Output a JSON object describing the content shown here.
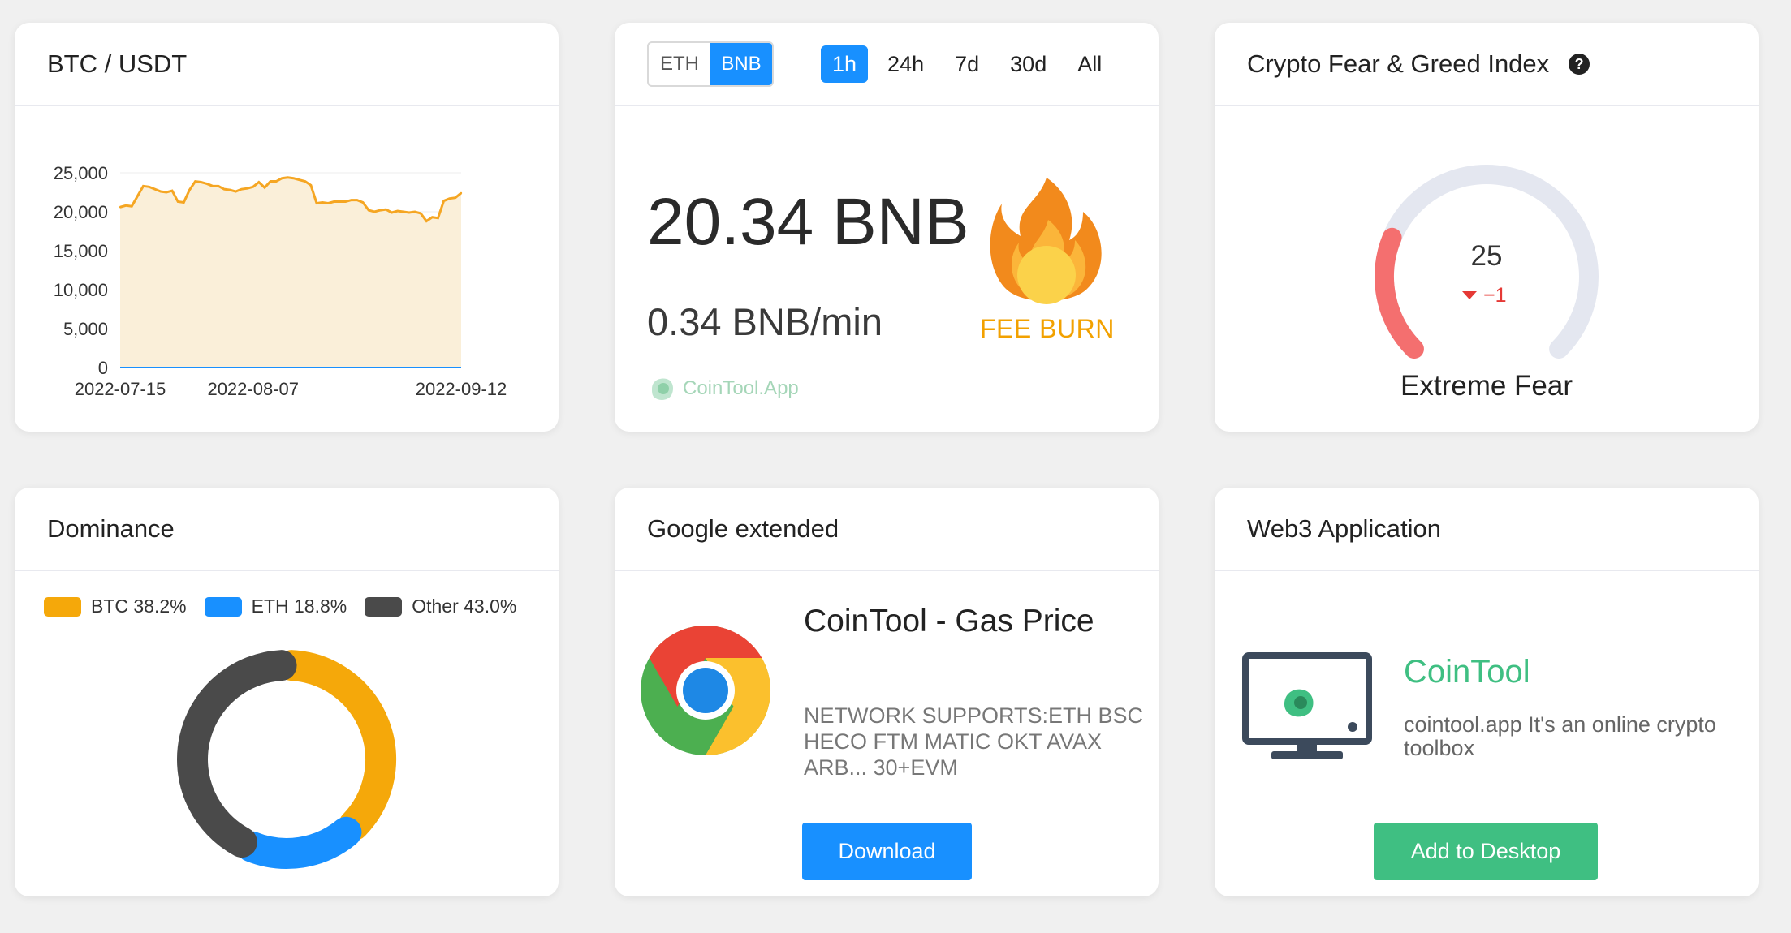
{
  "btc_card": {
    "title": "BTC / USDT"
  },
  "chart_data": {
    "type": "area",
    "title": "BTC / USDT",
    "xlabel": "",
    "ylabel": "",
    "y_ticks": [
      "0",
      "5,000",
      "10,000",
      "15,000",
      "20,000",
      "25,000"
    ],
    "x_ticks": [
      "2022-07-15",
      "2022-08-07",
      "2022-09-12"
    ],
    "ylim": [
      0,
      25000
    ],
    "x": [
      "2022-07-15",
      "2022-07-16",
      "2022-07-17",
      "2022-07-18",
      "2022-07-19",
      "2022-07-20",
      "2022-07-21",
      "2022-07-22",
      "2022-07-23",
      "2022-07-24",
      "2022-07-25",
      "2022-07-26",
      "2022-07-27",
      "2022-07-28",
      "2022-07-29",
      "2022-07-30",
      "2022-07-31",
      "2022-08-01",
      "2022-08-02",
      "2022-08-03",
      "2022-08-04",
      "2022-08-05",
      "2022-08-06",
      "2022-08-07",
      "2022-08-08",
      "2022-08-09",
      "2022-08-10",
      "2022-08-11",
      "2022-08-12",
      "2022-08-13",
      "2022-08-14",
      "2022-08-15",
      "2022-08-16",
      "2022-08-17",
      "2022-08-18",
      "2022-08-19",
      "2022-08-20",
      "2022-08-21",
      "2022-08-22",
      "2022-08-23",
      "2022-08-24",
      "2022-08-25",
      "2022-08-26",
      "2022-08-27",
      "2022-08-28",
      "2022-08-29",
      "2022-08-30",
      "2022-08-31",
      "2022-09-01",
      "2022-09-02",
      "2022-09-03",
      "2022-09-04",
      "2022-09-05",
      "2022-09-06",
      "2022-09-07",
      "2022-09-08",
      "2022-09-09",
      "2022-09-10",
      "2022-09-11",
      "2022-09-12"
    ],
    "values": [
      20600,
      20800,
      20700,
      22000,
      23300,
      23200,
      22900,
      22600,
      22500,
      22700,
      21300,
      21200,
      22800,
      23900,
      23800,
      23600,
      23300,
      23300,
      22900,
      22800,
      22600,
      22900,
      23000,
      23200,
      23800,
      23100,
      23900,
      23900,
      24300,
      24400,
      24300,
      24100,
      23900,
      23400,
      21100,
      21200,
      21100,
      21300,
      21300,
      21300,
      21500,
      21500,
      21200,
      20200,
      20000,
      20200,
      20300,
      19900,
      20100,
      20000,
      19900,
      20000,
      19800,
      18800,
      19300,
      19200,
      21400,
      21700,
      21800,
      22400
    ],
    "area_fill": "#faefd9",
    "line_color": "#f5a623",
    "grid": true
  },
  "burn_card": {
    "chains": [
      "ETH",
      "BNB"
    ],
    "active_chain": "BNB",
    "periods": [
      "1h",
      "24h",
      "7d",
      "30d",
      "All"
    ],
    "active_period": "1h",
    "total": "20.34 BNB",
    "rate": "0.34 BNB/min",
    "brand": "CoinTool.App",
    "label": "FEE BURN"
  },
  "fear_card": {
    "title": "Crypto Fear & Greed Index",
    "help_icon": "question-circle-icon",
    "value": "25",
    "change": "−1",
    "level": 25,
    "status": "Extreme Fear",
    "accent": "#f46f6f",
    "track": "#e4e7f0"
  },
  "dominance_card": {
    "title": "Dominance",
    "legend": [
      {
        "label": "BTC 38.2%",
        "color": "#f5a80a",
        "value": 38.2
      },
      {
        "label": "ETH 18.8%",
        "color": "#1890ff",
        "value": 18.8
      },
      {
        "label": "Other 43.0%",
        "color": "#4a4a4a",
        "value": 43.0
      }
    ]
  },
  "google_card": {
    "title": "Google extended",
    "ext_title": "CoinTool - Gas Price",
    "ext_desc": "NETWORK SUPPORTS:ETH BSC HECO FTM MATIC OKT AVAX ARB... 30+EVM",
    "button": "Download"
  },
  "web3_card": {
    "title": "Web3 Application",
    "app_name": "CoinTool",
    "app_desc": "cointool.app It's an online crypto toolbox",
    "button": "Add to Desktop"
  }
}
